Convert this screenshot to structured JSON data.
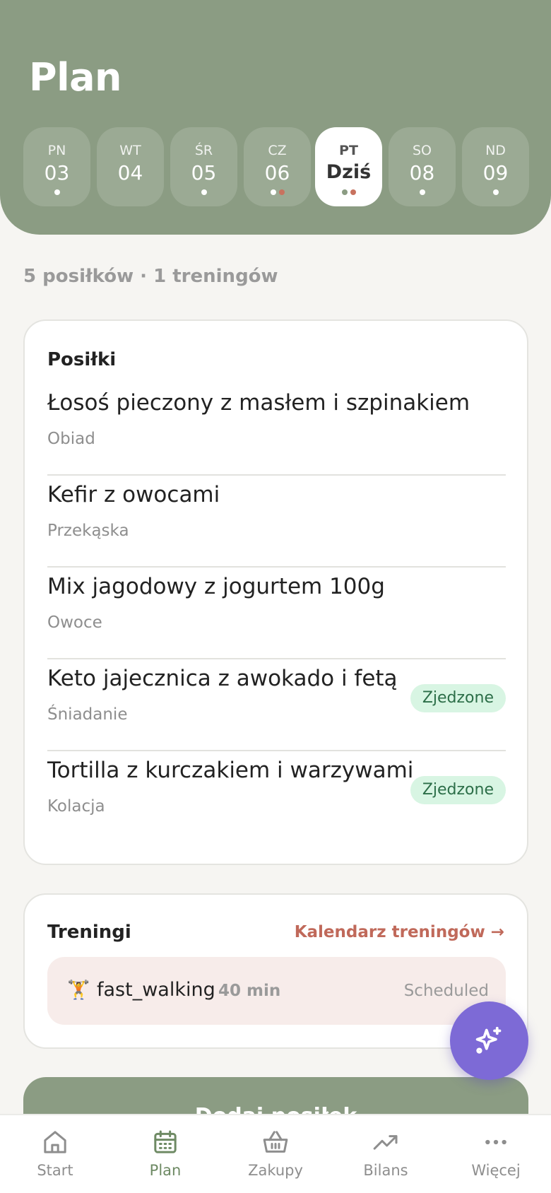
{
  "header": {
    "title": "Plan"
  },
  "days": [
    {
      "name": "PN",
      "date": "03",
      "dots": [
        "white"
      ]
    },
    {
      "name": "WT",
      "date": "04",
      "dots": []
    },
    {
      "name": "ŚR",
      "date": "05",
      "dots": [
        "white"
      ]
    },
    {
      "name": "CZ",
      "date": "06",
      "dots": [
        "white",
        "red"
      ]
    },
    {
      "name": "PT",
      "date": "Dziś",
      "dots": [
        "grey",
        "red"
      ],
      "active": true
    },
    {
      "name": "SO",
      "date": "08",
      "dots": [
        "white"
      ]
    },
    {
      "name": "ND",
      "date": "09",
      "dots": [
        "white"
      ]
    }
  ],
  "summary": "5 posiłków · 1 treningów",
  "meals": {
    "title": "Posiłki",
    "items": [
      {
        "name": "Łosoś pieczony z masłem i szpinakiem",
        "type": "Obiad",
        "badge": ""
      },
      {
        "name": "Kefir z owocami",
        "type": "Przekąska",
        "badge": ""
      },
      {
        "name": "Mix jagodowy z jogurtem 100g",
        "type": "Owoce",
        "badge": ""
      },
      {
        "name": "Keto jajecznica z awokado i fetą",
        "type": "Śniadanie",
        "badge": "Zjedzone"
      },
      {
        "name": "Tortilla z kurczakiem i warzywami",
        "type": "Kolacja",
        "badge": "Zjedzone"
      }
    ]
  },
  "trainings": {
    "title": "Treningi",
    "calendar_link": "Kalendarz treningów →",
    "workout": {
      "icon": "🏋",
      "name": "fast_walking",
      "duration": "40 min",
      "status": "Scheduled"
    }
  },
  "add_button": {
    "label": "Dodaj posiłek"
  },
  "fab": {
    "icon": "sparkles-icon"
  },
  "tabs": [
    {
      "label": "Start",
      "icon": "home-icon"
    },
    {
      "label": "Plan",
      "icon": "calendar-icon",
      "active": true
    },
    {
      "label": "Zakupy",
      "icon": "basket-icon"
    },
    {
      "label": "Bilans",
      "icon": "trend-icon"
    },
    {
      "label": "Więcej",
      "icon": "more-icon"
    }
  ],
  "colors": {
    "header_bg": "#8b9c83",
    "accent": "#7d6ad6",
    "link": "#c0695a",
    "badge_bg": "#d8f5e3"
  }
}
